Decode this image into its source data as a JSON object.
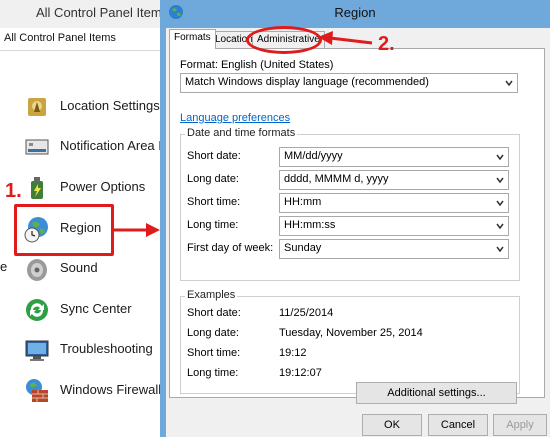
{
  "control_panel": {
    "title": "All Control Panel Items",
    "breadcrumb": "All Control Panel Items",
    "edge_text": "e",
    "items": [
      {
        "label": "Location Settings",
        "icon": "location-settings-icon"
      },
      {
        "label": "Notification Area I",
        "icon": "notification-area-icon"
      },
      {
        "label": "Power Options",
        "icon": "power-options-icon"
      },
      {
        "label": "Region",
        "icon": "region-globe-clock-icon"
      },
      {
        "label": "Sound",
        "icon": "sound-speaker-icon"
      },
      {
        "label": "Sync Center",
        "icon": "sync-center-icon"
      },
      {
        "label": "Troubleshooting",
        "icon": "troubleshooting-icon"
      },
      {
        "label": "Windows Firewall",
        "icon": "windows-firewall-icon"
      }
    ]
  },
  "annotations": {
    "step1": "1.",
    "step2": "2.",
    "color": "#e01b1b"
  },
  "dialog": {
    "title": "Region",
    "icon": "region-globe-icon",
    "tabs": [
      {
        "label": "Formats",
        "selected": true
      },
      {
        "label": "Location",
        "selected": false
      },
      {
        "label": "Administrative",
        "selected": false
      }
    ],
    "format_label": "Format: English (United States)",
    "format_value": "Match Windows display language (recommended)",
    "language_link": "Language preferences",
    "datetime_group": {
      "title": "Date and time formats",
      "rows": [
        {
          "label": "Short date:",
          "value": "MM/dd/yyyy"
        },
        {
          "label": "Long date:",
          "value": "dddd, MMMM d, yyyy"
        },
        {
          "label": "Short time:",
          "value": "HH:mm"
        },
        {
          "label": "Long time:",
          "value": "HH:mm:ss"
        },
        {
          "label": "First day of week:",
          "value": "Sunday"
        }
      ]
    },
    "examples_group": {
      "title": "Examples",
      "rows": [
        {
          "label": "Short date:",
          "value": "11/25/2014"
        },
        {
          "label": "Long date:",
          "value": "Tuesday, November 25, 2014"
        },
        {
          "label": "Short time:",
          "value": "19:12"
        },
        {
          "label": "Long time:",
          "value": "19:12:07"
        }
      ]
    },
    "buttons": {
      "additional": "Additional settings...",
      "ok": "OK",
      "cancel": "Cancel",
      "apply": "Apply"
    },
    "accent": "#6fa9dc",
    "link_color": "#0066cc"
  }
}
